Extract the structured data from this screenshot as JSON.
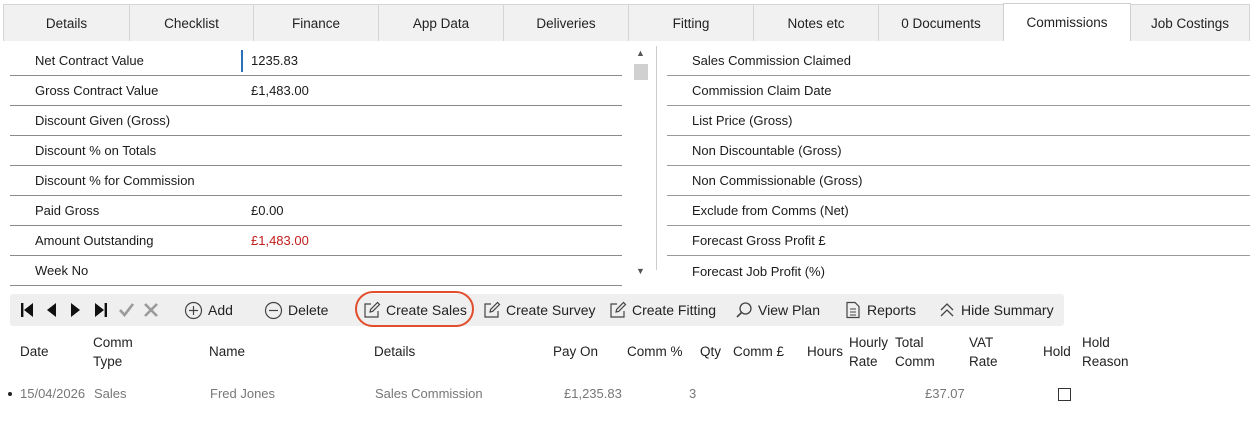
{
  "tabs": [
    {
      "label": "Details",
      "active": false
    },
    {
      "label": "Checklist",
      "active": false
    },
    {
      "label": "Finance",
      "active": false
    },
    {
      "label": "App Data",
      "active": false
    },
    {
      "label": "Deliveries",
      "active": false
    },
    {
      "label": "Fitting",
      "active": false
    },
    {
      "label": "Notes etc",
      "active": false
    },
    {
      "label": "0 Documents",
      "active": false
    },
    {
      "label": "Commissions",
      "active": true
    },
    {
      "label": "Job Costings",
      "active": false
    }
  ],
  "summary_left": [
    {
      "label": "Net Contract Value",
      "value": "1235.83"
    },
    {
      "label": "Gross Contract Value",
      "value": "£1,483.00"
    },
    {
      "label": "Discount Given (Gross)",
      "value": ""
    },
    {
      "label": "Discount % on Totals",
      "value": ""
    },
    {
      "label": "Discount % for Commission",
      "value": ""
    },
    {
      "label": "Paid Gross",
      "value": "£0.00"
    },
    {
      "label": "Amount Outstanding",
      "value": "£1,483.00"
    },
    {
      "label": "Week No",
      "value": ""
    }
  ],
  "summary_right": [
    {
      "label": "Sales Commission Claimed"
    },
    {
      "label": "Commission Claim Date"
    },
    {
      "label": "List Price (Gross)"
    },
    {
      "label": "Non Discountable (Gross)"
    },
    {
      "label": "Non Commissionable (Gross)"
    },
    {
      "label": "Exclude from Comms (Net)"
    },
    {
      "label": "Forecast Gross Profit £"
    },
    {
      "label": "Forecast Job Profit (%)"
    }
  ],
  "colors": {
    "outstanding": "#c0201e",
    "highlight_ring": "#e24d2b",
    "focus_bar": "#2a6fba"
  },
  "toolbar": {
    "nav_icons": [
      "first-record-icon",
      "prev-record-icon",
      "next-record-icon",
      "last-record-icon",
      "save-check-icon",
      "cancel-x-icon"
    ],
    "add_label": "Add",
    "delete_label": "Delete",
    "create_sales_label": "Create Sales",
    "create_survey_label": "Create Survey",
    "create_fitting_label": "Create Fitting",
    "view_plan_label": "View Plan",
    "reports_label": "Reports",
    "hide_summary_label": "Hide Summary"
  },
  "table": {
    "headers": {
      "date": "Date",
      "comm_type_1": "Comm",
      "comm_type_2": "Type",
      "name": "Name",
      "details": "Details",
      "pay_on": "Pay On",
      "comm_pct": "Comm %",
      "qty": "Qty",
      "comm_gbp": "Comm £",
      "hours": "Hours",
      "hourly_rate_1": "Hourly",
      "hourly_rate_2": "Rate",
      "total_comm_1": "Total",
      "total_comm_2": "Comm",
      "vat_rate_1": "VAT",
      "vat_rate_2": "Rate",
      "hold": "Hold",
      "hold_reason_1": "Hold",
      "hold_reason_2": "Reason"
    },
    "rows": [
      {
        "date": "15/04/2026",
        "comm_type": "Sales",
        "name": "Fred Jones",
        "details": "Sales Commission",
        "pay_on": "£1,235.83",
        "qty": "3",
        "total_comm": "£37.07",
        "hold": false
      }
    ]
  }
}
